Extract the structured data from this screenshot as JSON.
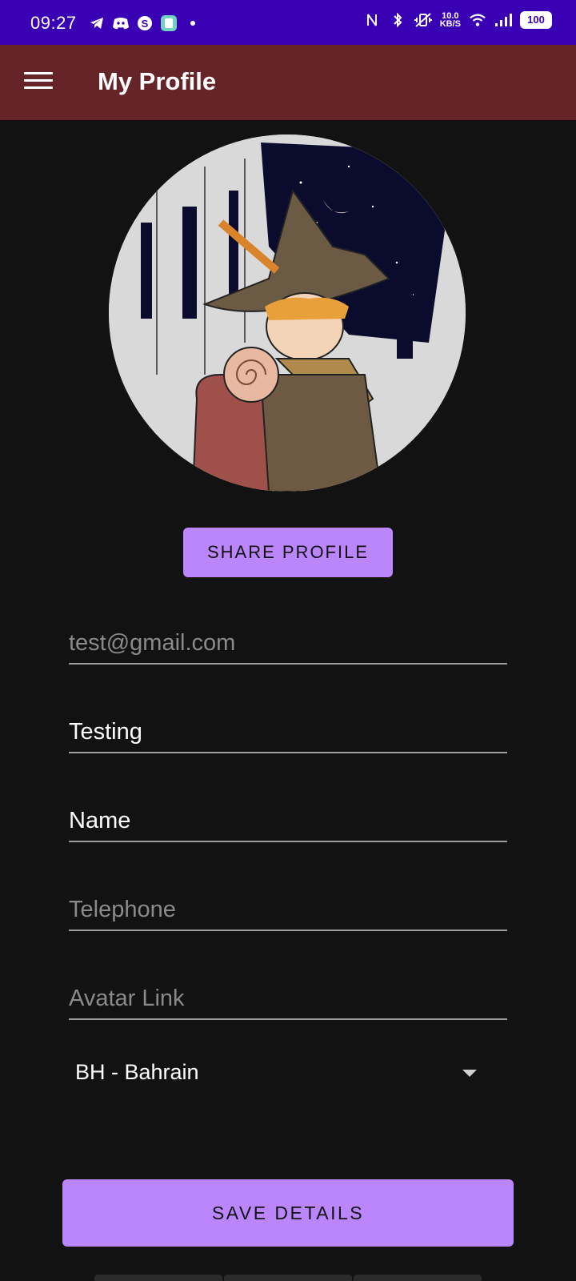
{
  "status_bar": {
    "time": "09:27",
    "left_icons": [
      "telegram-icon",
      "discord-icon",
      "skype-icon",
      "app-icon",
      "dot-icon"
    ],
    "right_icons": [
      "nfc-icon",
      "bluetooth-icon",
      "vibrate-icon",
      "wifi-icon",
      "signal-icon"
    ],
    "net_speed_value": "10.0",
    "net_speed_unit": "KB/S",
    "battery": "100"
  },
  "app_bar": {
    "title": "My Profile",
    "menu_icon": "menu-icon"
  },
  "profile": {
    "share_label": "SHARE PROFILE",
    "fields": {
      "email_placeholder": "test@gmail.com",
      "username_value": "Testing",
      "name_value": "Name",
      "telephone_placeholder": "Telephone",
      "avatar_link_placeholder": "Avatar Link"
    },
    "country_selected": "BH - Bahrain",
    "save_label": "SAVE DETAILS"
  },
  "colors": {
    "status_bar": "#3a00b3",
    "app_bar": "#652427",
    "background": "#121212",
    "accent": "#bb86fc"
  }
}
